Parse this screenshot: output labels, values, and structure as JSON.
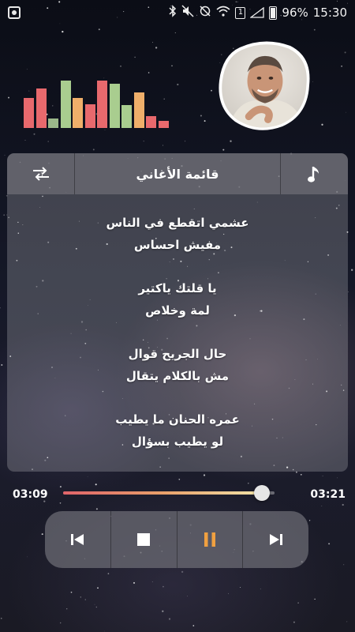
{
  "status_bar": {
    "sim_label": "1",
    "battery": "96%",
    "time": "15:30"
  },
  "equalizer": {
    "levels": [
      0.62,
      0.8,
      0.2,
      0.97,
      0.62,
      0.48,
      0.97,
      0.9,
      0.46,
      0.72,
      0.24,
      0.15
    ],
    "colors": [
      "#e8696d",
      "#e8696d",
      "#9bb88a",
      "#a9cd8f",
      "#efaf6a",
      "#e8696d",
      "#e8696d",
      "#a9cd8f",
      "#a9cd8f",
      "#efaf6a",
      "#e8696d",
      "#e8696d"
    ]
  },
  "avatar": {
    "icon": "artist-photo"
  },
  "playlist_card": {
    "title": "قائمة الأغاني",
    "left_icon": "repeat-icon",
    "right_icon": "music-note-icon",
    "lyrics": [
      [
        "عشمي اتقطع في الناس",
        "مفيش احساس"
      ],
      [
        "يا قلتك ياكتير",
        "لمة وخلاص"
      ],
      [
        "حال الجريح قوال",
        "مش بالكلام يتقال"
      ],
      [
        "عمره الحنان ما يطيب",
        "لو يطيب بسؤال"
      ]
    ]
  },
  "player": {
    "elapsed": "03:09",
    "total": "03:21",
    "progress": 0.94,
    "progress_gradient": [
      "#e0646a",
      "#e9a06a",
      "#f1e3a8"
    ],
    "controls": [
      {
        "name": "previous-button",
        "icon": "skip-previous-icon",
        "color": "#ffffff"
      },
      {
        "name": "stop-button",
        "icon": "stop-icon",
        "color": "#ffffff"
      },
      {
        "name": "pause-button",
        "icon": "pause-icon",
        "color": "#f0a040"
      },
      {
        "name": "next-button",
        "icon": "skip-next-icon",
        "color": "#ffffff"
      }
    ]
  }
}
